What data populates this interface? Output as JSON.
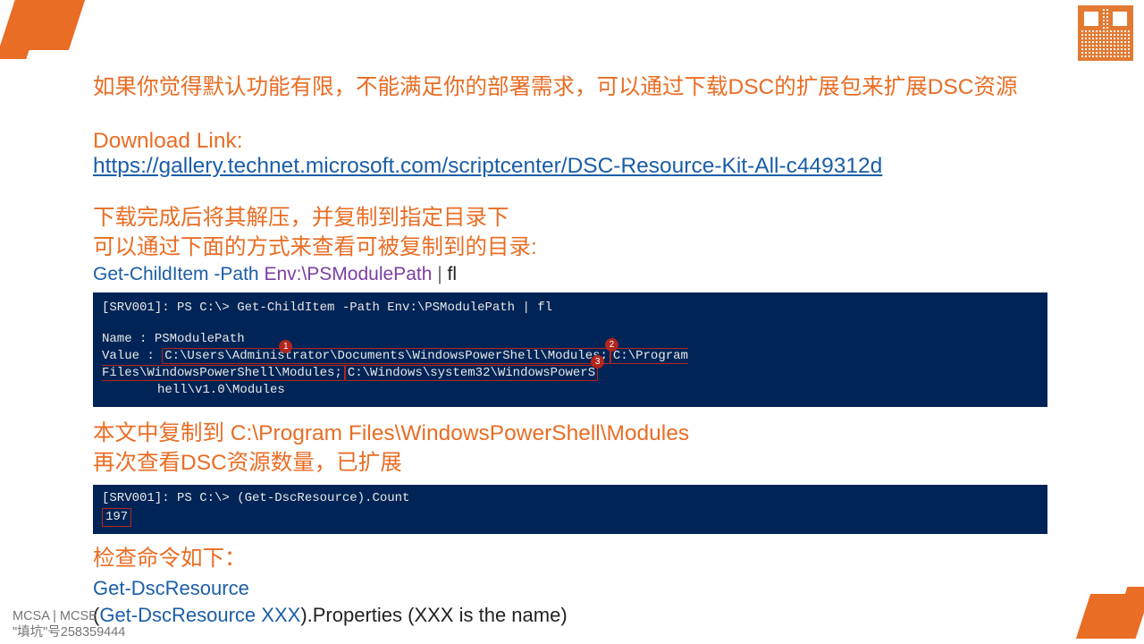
{
  "intro": "如果你觉得默认功能有限，不能满足你的部署需求，可以通过下载DSC的扩展包来扩展DSC资源",
  "download": {
    "label": "Download Link:",
    "url": "https://gallery.technet.microsoft.com/scriptcenter/DSC-Resource-Kit-All-c449312d"
  },
  "instr1": "下载完成后将其解压，并复制到指定目录下",
  "instr2": "可以通过下面的方式来查看可被复制到的目录:",
  "cmd1": {
    "cmdlet": "Get-ChildItem",
    "paramflag": "-Path",
    "param": "Env:\\PSModulePath",
    "pipe": "|",
    "tail": "fl"
  },
  "term1": {
    "prompt": "[SRV001]: PS C:\\> Get-ChildItem -Path Env:\\PSModulePath | fl",
    "nameLabel": "Name  : ",
    "nameValue": "PSModulePath",
    "valueLabel": "Value : ",
    "seg1": "C:\\Users\\Administrator\\Documents\\WindowsPowerShell\\Modules;",
    "seg2": "C:\\Program Files\\WindowsPowerShell\\Modules;",
    "seg3": "C:\\Windows\\system32\\WindowsPowerS",
    "cont": "hell\\v1.0\\Modules",
    "badges": [
      "1",
      "2",
      "3"
    ]
  },
  "instr3": "本文中复制到 C:\\Program Files\\WindowsPowerShell\\Modules",
  "instr4": "再次查看DSC资源数量，已扩展",
  "term2": {
    "prompt": "[SRV001]: PS C:\\> (Get-DscResource).Count",
    "result": "197"
  },
  "checkLabel": "检查命令如下：",
  "check1": " Get-DscResource",
  "check2": {
    "open": "(",
    "cmd": "Get-DscResource",
    "arg": " XXX",
    "close": ").Properties (XXX is the name)"
  },
  "footer1": "MCSA | MCSE",
  "footer2": "\"填坑\"号258359444"
}
